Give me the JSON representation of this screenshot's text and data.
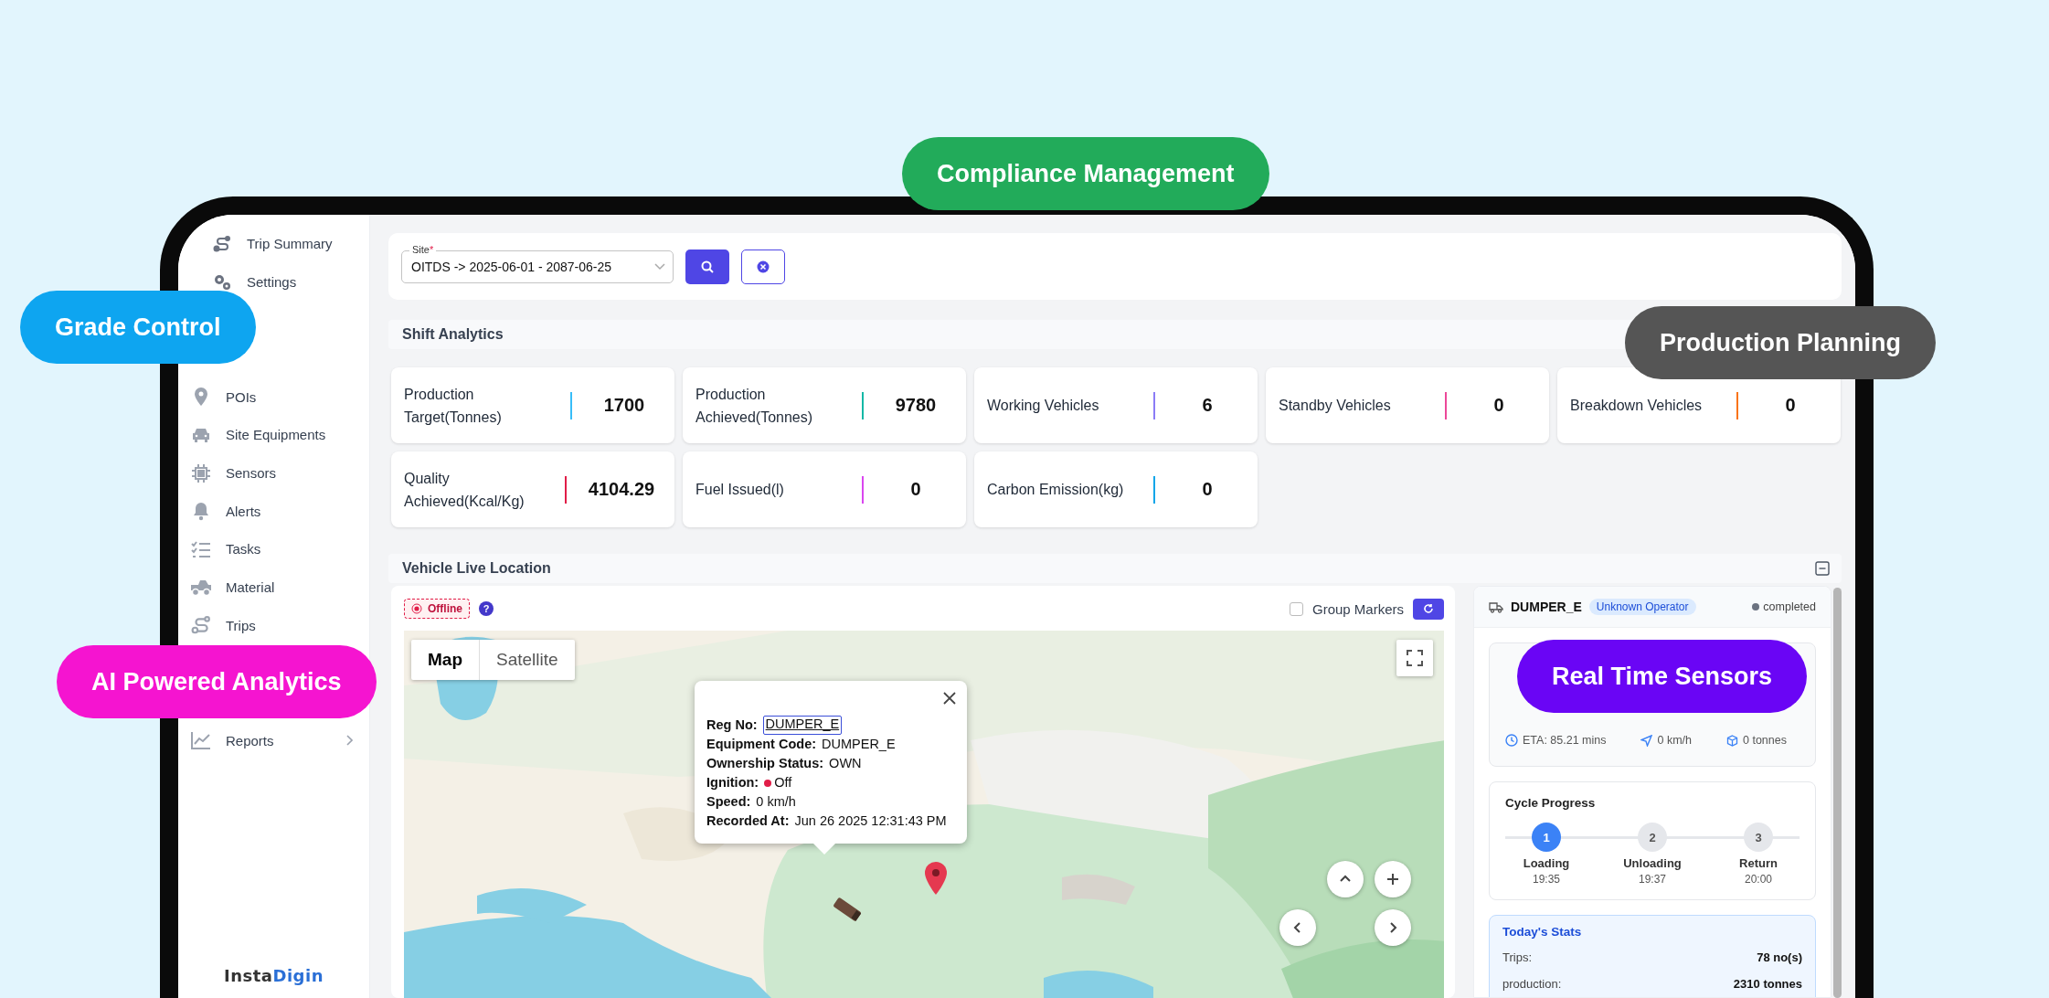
{
  "promo_labels": [
    {
      "text": "Compliance Management",
      "color": "#22ab5a"
    },
    {
      "text": "Grade Control",
      "color": "#0ea5f0"
    },
    {
      "text": "Production Planning",
      "color": "#555555"
    },
    {
      "text": "AI Powered Analytics",
      "color": "#f514d0"
    },
    {
      "text": "Real Time Sensors",
      "color": "#6a05f5"
    }
  ],
  "sidebar": {
    "items": [
      {
        "label": "Trip Summary",
        "kind": "subitem"
      },
      {
        "label": "Settings",
        "kind": "subitem"
      },
      {
        "label": "POIs",
        "kind": "item"
      },
      {
        "label": "Site Equipments",
        "kind": "item"
      },
      {
        "label": "Sensors",
        "kind": "item"
      },
      {
        "label": "Alerts",
        "kind": "item"
      },
      {
        "label": "Tasks",
        "kind": "item"
      },
      {
        "label": "Material",
        "kind": "item"
      },
      {
        "label": "Trips",
        "kind": "item"
      },
      {
        "label": "Reports",
        "kind": "group"
      }
    ],
    "logo": {
      "parts": [
        "Insta",
        "Digin"
      ]
    }
  },
  "filter": {
    "label": "Site",
    "required_mark": "*",
    "value": "OITDS -> 2025-06-01 - 2087-06-25"
  },
  "shift_analytics": {
    "title": "Shift Analytics",
    "cards": [
      {
        "label": "Production Target(Tonnes)",
        "value": "1700",
        "color": "#38bdf8"
      },
      {
        "label": "Production Achieved(Tonnes)",
        "value": "9780",
        "color": "#14b8a6"
      },
      {
        "label": "Working Vehicles",
        "value": "6",
        "color": "#8b7cf6"
      },
      {
        "label": "Standby Vehicles",
        "value": "0",
        "color": "#ec4899"
      },
      {
        "label": "Breakdown Vehicles",
        "value": "0",
        "color": "#f97316"
      },
      {
        "label": "Quality Achieved(Kcal/Kg)",
        "value": "4104.29",
        "color": "#e11d48"
      },
      {
        "label": "Fuel Issued(l)",
        "value": "0",
        "color": "#d946ef"
      },
      {
        "label": "Carbon Emission(kg)",
        "value": "0",
        "color": "#0ea5e9"
      }
    ]
  },
  "vehicle_live_location": {
    "title": "Vehicle Live Location",
    "status": "Offline",
    "help": "?",
    "group_markers": {
      "label": "Group Markers",
      "checked": false
    },
    "map": {
      "kind": "picture",
      "map_types": [
        {
          "label": "Map",
          "selected": true
        },
        {
          "label": "Satellite",
          "selected": false
        }
      ],
      "popup": {
        "rows": [
          {
            "label": "Reg No:",
            "value": "DUMPER_E",
            "kind": "link"
          },
          {
            "label": "Equipment Code:",
            "value": "DUMPER_E",
            "kind": "text"
          },
          {
            "label": "Ownership Status:",
            "value": "OWN",
            "kind": "text"
          },
          {
            "label": "Ignition:",
            "value": "Off",
            "kind": "status"
          },
          {
            "label": "Speed:",
            "value": "0 km/h",
            "kind": "text"
          },
          {
            "label": "Recorded At:",
            "value": "Jun 26 2025 12:31:43 PM",
            "kind": "text"
          }
        ]
      }
    }
  },
  "vehicle_panel": {
    "name": "DUMPER_E",
    "operator": "Unknown Operator",
    "status": "completed",
    "trip": {
      "eta": "ETA: 85.21 mins",
      "speed": "0 km/h",
      "load": "0 tonnes"
    },
    "cycle": {
      "title": "Cycle Progress",
      "steps": [
        {
          "number": "1",
          "label": "Loading",
          "time": "19:35",
          "active": true
        },
        {
          "number": "2",
          "label": "Unloading",
          "time": "19:37",
          "active": false
        },
        {
          "number": "3",
          "label": "Return",
          "time": "20:00",
          "active": false
        }
      ]
    },
    "stats": {
      "title": "Today's Stats",
      "rows": [
        {
          "label": "Trips:",
          "value": "78 no(s)"
        },
        {
          "label": "production:",
          "value": "2310 tonnes"
        }
      ]
    }
  }
}
